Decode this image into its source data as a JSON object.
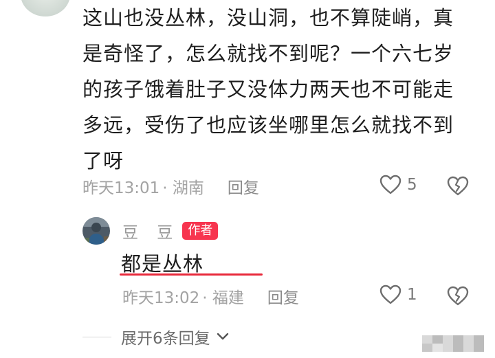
{
  "comment": {
    "lines": [
      "这山也没丛林，没山洞，也不算陡峭，真",
      "是奇怪了，怎么就找不到呢？一个六七岁",
      "的孩子饿着肚子又没体力两天也不可能走",
      "多远，受伤了也应该坐哪里怎么就找不到",
      "了呀"
    ],
    "time": "昨天13:01",
    "location": "· 湖南",
    "reply_label": "回复",
    "like_count": "5",
    "like_icon": "heart-outline-icon",
    "dislike_icon": "broken-heart-icon"
  },
  "reply": {
    "user_name": "豆 豆",
    "author_badge": "作者",
    "text": "都是丛林",
    "time": "昨天13:02",
    "location": "· 福建",
    "reply_label": "回复",
    "like_count": "1",
    "like_icon": "heart-outline-icon",
    "dislike_icon": "broken-heart-icon"
  },
  "expand_replies": {
    "label": "展开6条回复",
    "icon": "chevron-down-icon"
  },
  "colors": {
    "badge": "#f7354f",
    "underline": "#e8283a",
    "meta": "#a3a3a3"
  }
}
